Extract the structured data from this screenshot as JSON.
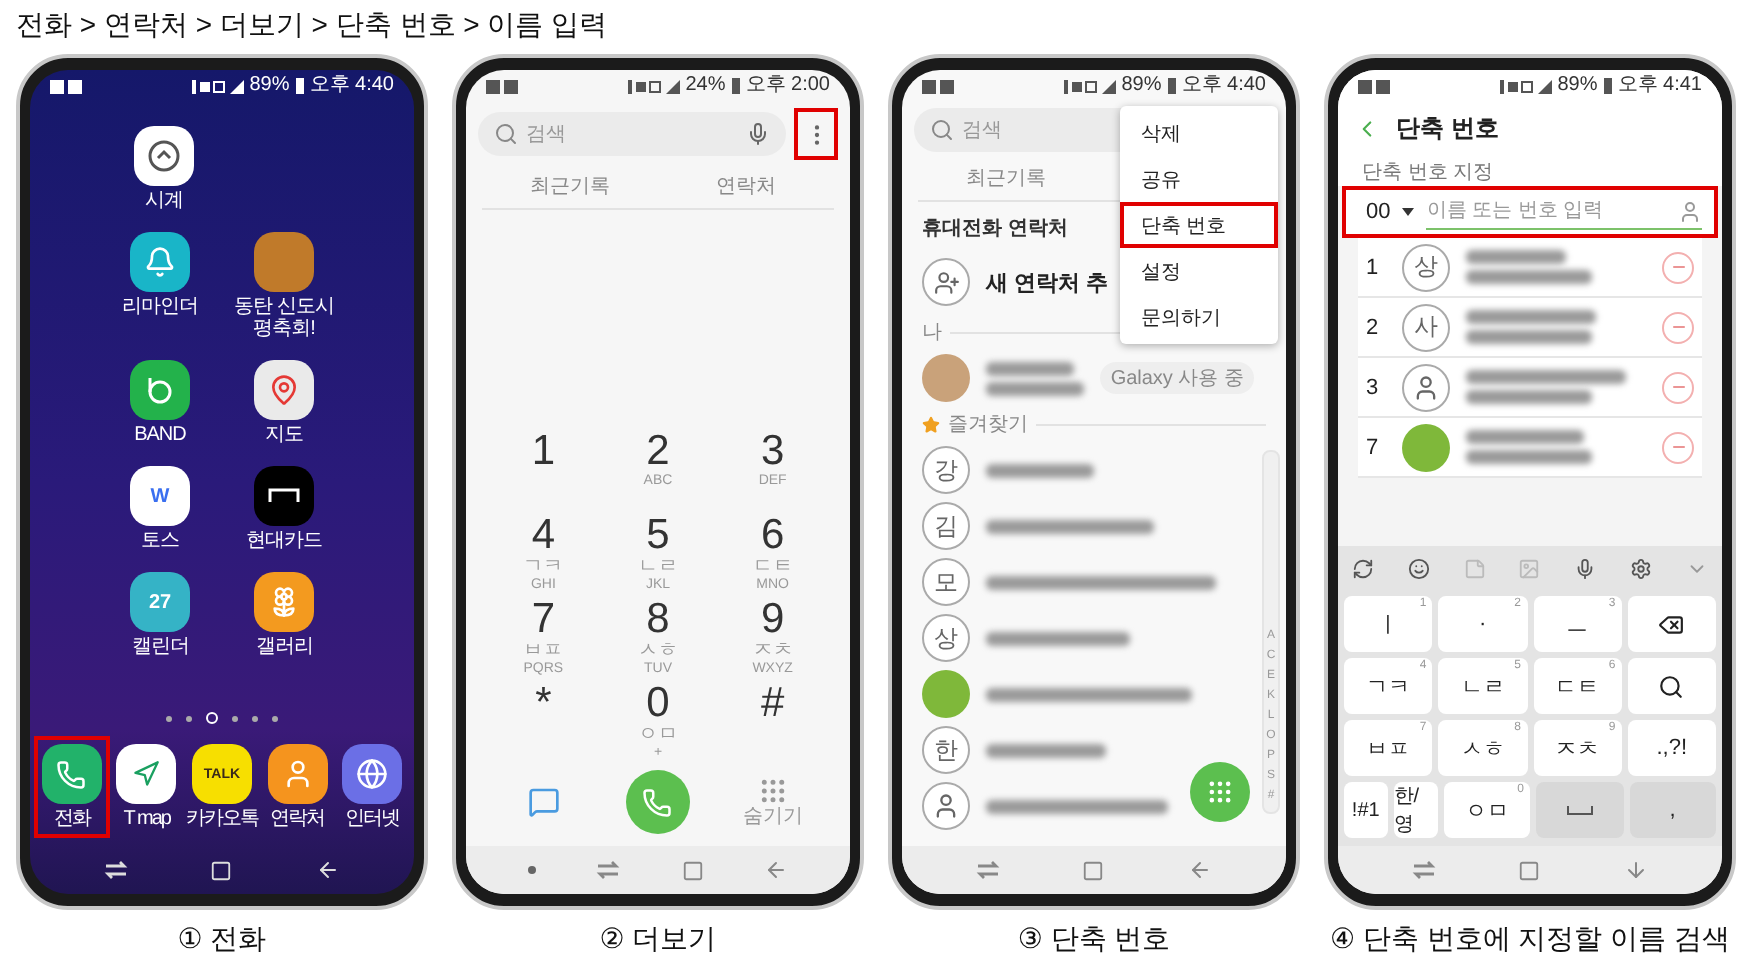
{
  "title": "전화 > 연락처 > 더보기 > 단축 번호 > 이름 입력",
  "phones": [
    {
      "kind": "home",
      "caption": "① 전화",
      "status": {
        "battery": "89%",
        "time": "오후 4:40"
      },
      "rows": [
        [
          {
            "label": "시계",
            "kind": "clock"
          }
        ],
        [
          {
            "label": "리마인더",
            "kind": "bell"
          },
          {
            "label": "동탄 신도시 평축회!",
            "kind": "photo"
          }
        ],
        [
          {
            "label": "BAND",
            "kind": "band"
          },
          {
            "label": "지도",
            "kind": "map"
          }
        ],
        [
          {
            "label": "토스",
            "kind": "chat",
            "icon_text": "W"
          },
          {
            "label": "현대카드",
            "kind": "card"
          }
        ],
        [
          {
            "label": "캘린더",
            "kind": "calendar",
            "icon_text": "27"
          },
          {
            "label": "갤러리",
            "kind": "flower"
          }
        ]
      ],
      "pages": [
        {
          "selected": false
        },
        {
          "selected": false
        },
        {
          "selected": true
        },
        {
          "selected": false
        },
        {
          "selected": false
        },
        {
          "selected": false
        }
      ],
      "dock": [
        {
          "label": "전화",
          "kind": "phone",
          "highlighted": true
        },
        {
          "label": "T map",
          "kind": "pin",
          "highlighted": false
        },
        {
          "label": "카카오톡",
          "kind": "talk",
          "icon_text": "TALK",
          "highlighted": false
        },
        {
          "label": "연락처",
          "kind": "person",
          "highlighted": false
        },
        {
          "label": "인터넷",
          "kind": "globe",
          "highlighted": false
        }
      ]
    },
    {
      "kind": "dialer",
      "caption": "② 더보기",
      "status": {
        "battery": "24%",
        "time": "오후 2:00"
      },
      "search": {
        "placeholder": "검색"
      },
      "more_highlighted": true,
      "tabs": [
        "최근기록",
        "연락처"
      ],
      "keys": [
        {
          "digit": "1"
        },
        {
          "digit": "2",
          "letters": "ABC"
        },
        {
          "digit": "3",
          "letters": "DEF"
        },
        {
          "digit": "4",
          "hangul": "ㄱㅋ",
          "letters": "GHI"
        },
        {
          "digit": "5",
          "hangul": "ㄴㄹ",
          "letters": "JKL"
        },
        {
          "digit": "6",
          "hangul": "ㄷㅌ",
          "letters": "MNO"
        },
        {
          "digit": "7",
          "hangul": "ㅂㅍ",
          "letters": "PQRS"
        },
        {
          "digit": "8",
          "hangul": "ㅅㅎ",
          "letters": "TUV"
        },
        {
          "digit": "9",
          "hangul": "ㅈㅊ",
          "letters": "WXYZ"
        },
        {
          "digit": "*"
        },
        {
          "digit": "0",
          "hangul": "ㅇㅁ",
          "letters": "+"
        },
        {
          "digit": "#"
        }
      ],
      "hide_label": "숨기기"
    },
    {
      "kind": "contacts",
      "caption": "③ 단축 번호",
      "status": {
        "battery": "89%",
        "time": "오후 4:40"
      },
      "search": {
        "placeholder": "검색"
      },
      "tabs": [
        "최근기록"
      ],
      "section": "휴대전화 연락처",
      "add_label": "새 연락처 추",
      "me_label": "나",
      "me_badge": "Galaxy 사용 중",
      "favorites_label": "즐겨찾기",
      "contacts": [
        {
          "kind": "letter",
          "initial": "강"
        },
        {
          "kind": "letter",
          "initial": "김"
        },
        {
          "kind": "letter",
          "initial": "모"
        },
        {
          "kind": "letter",
          "initial": "상"
        },
        {
          "kind": "photo"
        },
        {
          "kind": "letter",
          "initial": "한"
        },
        {
          "kind": "silhouette"
        }
      ],
      "index": [
        "A",
        "C",
        "E",
        "K",
        "L",
        "O",
        "P",
        "S",
        "#"
      ],
      "menu": [
        {
          "label": "삭제",
          "highlighted": false
        },
        {
          "label": "공유",
          "highlighted": false
        },
        {
          "label": "단축 번호",
          "highlighted": true
        },
        {
          "label": "설정",
          "highlighted": false
        },
        {
          "label": "문의하기",
          "highlighted": false
        }
      ]
    },
    {
      "kind": "speed_dial",
      "caption": "④ 단축 번호에 지정할 이름 검색",
      "status": {
        "battery": "89%",
        "time": "오후 4:41"
      },
      "heading": "단축 번호",
      "field_label": "단축 번호 지정",
      "input": {
        "number": "00",
        "placeholder": "이름 또는 번호 입력",
        "highlighted": true
      },
      "entries": [
        {
          "number": "1",
          "kind": "letter",
          "initial": "상"
        },
        {
          "number": "2",
          "kind": "letter",
          "initial": "사"
        },
        {
          "number": "3",
          "kind": "silhouette"
        },
        {
          "number": "7",
          "kind": "photo"
        }
      ],
      "keyboard": [
        [
          {
            "kind": "char",
            "label": "ㅣ",
            "hint": "1"
          },
          {
            "kind": "char",
            "label": "·",
            "hint": "2"
          },
          {
            "kind": "char",
            "label": "ㅡ",
            "hint": "3"
          },
          {
            "kind": "backspace"
          }
        ],
        [
          {
            "kind": "char",
            "label": "ㄱㅋ",
            "hint": "4"
          },
          {
            "kind": "char",
            "label": "ㄴㄹ",
            "hint": "5"
          },
          {
            "kind": "char",
            "label": "ㄷㅌ",
            "hint": "6"
          },
          {
            "kind": "search"
          }
        ],
        [
          {
            "kind": "char",
            "label": "ㅂㅍ",
            "hint": "7"
          },
          {
            "kind": "char",
            "label": "ㅅㅎ",
            "hint": "8"
          },
          {
            "kind": "char",
            "label": "ㅈㅊ",
            "hint": "9"
          },
          {
            "kind": "char",
            "label": ".,?!"
          }
        ],
        [
          {
            "kind": "small",
            "label": "!#1"
          },
          {
            "kind": "small",
            "label": "한/영"
          },
          {
            "kind": "char",
            "label": "ㅇㅁ",
            "hint": "0"
          },
          {
            "kind": "space"
          },
          {
            "kind": "dim",
            "label": ","
          }
        ]
      ]
    }
  ]
}
